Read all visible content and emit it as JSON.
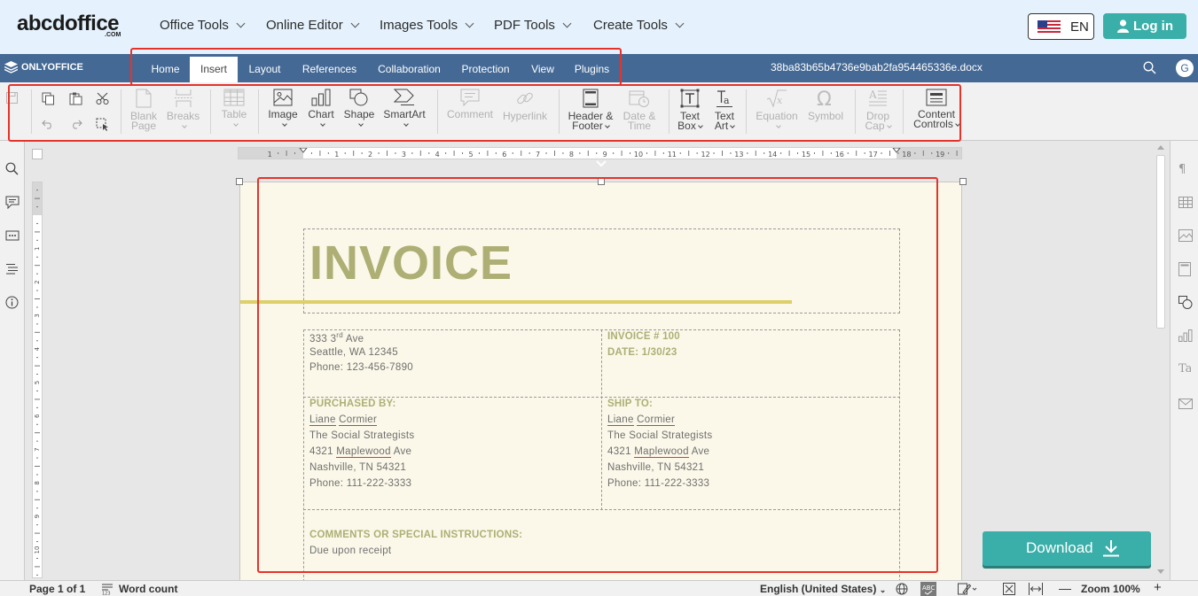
{
  "site": {
    "logo": "abcdoffice",
    "logo_sub": ".COM",
    "nav": [
      "Office Tools",
      "Online Editor",
      "Images Tools",
      "PDF Tools",
      "Create Tools"
    ],
    "lang": "EN",
    "login": "Log in"
  },
  "editor": {
    "brand": "ONLYOFFICE",
    "tabs": [
      "Home",
      "Insert",
      "Layout",
      "References",
      "Collaboration",
      "Protection",
      "View",
      "Plugins"
    ],
    "active_tab": "Insert",
    "file_name": "38ba83b65b4736e9bab2fa954465336e.docx",
    "avatar": "G"
  },
  "toolbar": {
    "blank_page": [
      "Blank",
      "Page"
    ],
    "breaks": "Breaks",
    "table": "Table",
    "image": "Image",
    "chart": "Chart",
    "shape": "Shape",
    "smartart": "SmartArt",
    "comment": "Comment",
    "hyperlink": "Hyperlink",
    "header_footer": [
      "Header &",
      "Footer"
    ],
    "date_time": [
      "Date &",
      "Time"
    ],
    "text_box": [
      "Text",
      "Box"
    ],
    "text_art": [
      "Text",
      "Art"
    ],
    "equation": "Equation",
    "symbol": "Symbol",
    "drop_cap": [
      "Drop",
      "Cap"
    ],
    "content_controls": [
      "Content",
      "Controls"
    ]
  },
  "ruler": {
    "numbers": [
      "1",
      "1",
      "2",
      "3",
      "4",
      "5",
      "6",
      "7",
      "8",
      "9",
      "10",
      "11",
      "12",
      "13",
      "14",
      "15",
      "16",
      "17",
      "18",
      "19"
    ],
    "vnumbers": [
      "1",
      "1",
      "2",
      "3",
      "4",
      "5",
      "6",
      "7",
      "8",
      "9",
      "10"
    ]
  },
  "document": {
    "title": "INVOICE",
    "address": {
      "line1_pre": "333 3",
      "line1_sup": "rd",
      "line1_post": " Ave",
      "line2": "Seattle, WA 12345",
      "line3": "Phone: 123-456-7890"
    },
    "invoice_no": "INVOICE # 100",
    "date": "DATE: 1/30/23",
    "purchased_by": {
      "head": "PURCHASED BY:",
      "first": "Liane",
      "last": "Cormier",
      "company": "The Social Strategists",
      "street_num": "4321",
      "street_name": "Maplewood",
      "street_suffix": "Ave",
      "city": "Nashville, TN 54321",
      "phone": "Phone: 111-222-3333"
    },
    "ship_to": {
      "head": "SHIP TO:",
      "first": "Liane",
      "last": "Cormier",
      "company": "The Social Strategists",
      "street_num": "4321",
      "street_name": "Maplewood",
      "street_suffix": "Ave",
      "city": "Nashville, TN 54321",
      "phone": "Phone: 111-222-3333"
    },
    "comments_head": "COMMENTS OR SPECIAL INSTRUCTIONS:",
    "comments": "Due upon receipt"
  },
  "download": "Download",
  "status": {
    "page": "Page 1 of 1",
    "word_count": "Word count",
    "language": "English (United States)",
    "zoom": "Zoom 100%"
  },
  "colors": {
    "accent": "#3aaea8",
    "editor_bar": "#446995",
    "invoice_title": "#adaf75",
    "highlight_box": "#e5332a"
  }
}
